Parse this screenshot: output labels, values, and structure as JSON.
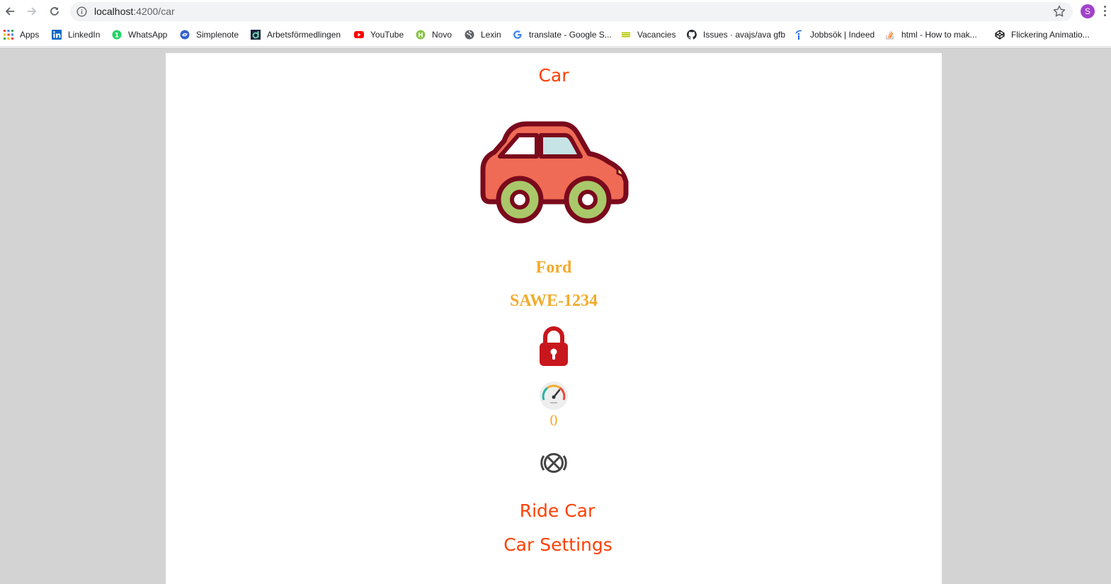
{
  "browser": {
    "url_host": "localhost",
    "url_path": ":4200/car",
    "profile_initial": "S"
  },
  "bookmarks": [
    {
      "label": "Apps",
      "icon": "apps-grid-icon",
      "color": "#4285f4"
    },
    {
      "label": "LinkedIn",
      "icon": "linkedin-icon",
      "color": "#0a66c2"
    },
    {
      "label": "WhatsApp",
      "icon": "whatsapp-icon",
      "color": "#25d366"
    },
    {
      "label": "Simplenote",
      "icon": "simplenote-icon",
      "color": "#3361cc"
    },
    {
      "label": "Arbetsförmedlingen",
      "icon": "arbetsformedlingen-icon",
      "color": "#1b2540"
    },
    {
      "label": "YouTube",
      "icon": "youtube-icon",
      "color": "#ff0000"
    },
    {
      "label": "Novo",
      "icon": "novo-icon",
      "color": "#8bc34a"
    },
    {
      "label": "Lexin",
      "icon": "globe-icon",
      "color": "#5f6368"
    },
    {
      "label": "translate - Google S...",
      "icon": "google-icon",
      "color": "#4285f4"
    },
    {
      "label": "Vacancies",
      "icon": "vacancies-icon",
      "color": "#c5d800"
    },
    {
      "label": "Issues · avajs/ava gfb",
      "icon": "github-icon",
      "color": "#24292e"
    },
    {
      "label": "Jobbsök | Indeed",
      "icon": "indeed-icon",
      "color": "#2164f3"
    },
    {
      "label": "html - How to mak...",
      "icon": "stackoverflow-icon",
      "color": "#f48024"
    },
    {
      "label": "Flickering Animatio...",
      "icon": "codepen-icon",
      "color": "#111111"
    }
  ],
  "car": {
    "title": "Car",
    "brand": "Ford",
    "plate": "SAWE-1234",
    "speed": "0",
    "ride_link": "Ride Car",
    "settings_link": "Car Settings"
  },
  "colors": {
    "title_color": "#ff3f00",
    "info_color": "#f2ab2c",
    "page_background": "#d3d3d3",
    "lock_color": "#c8161d"
  }
}
